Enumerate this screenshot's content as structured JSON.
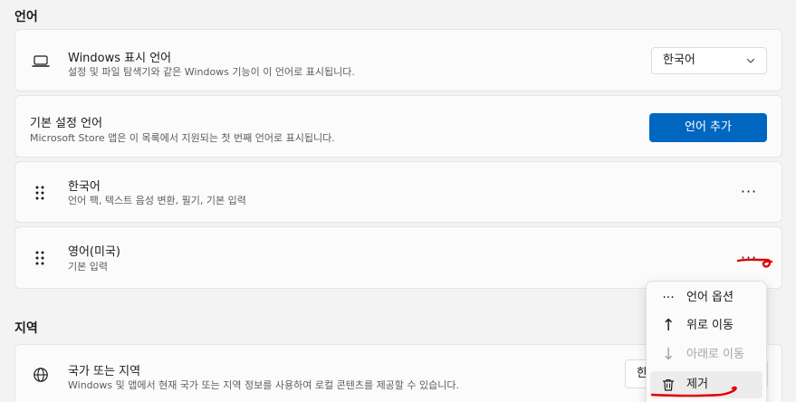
{
  "language_section": {
    "title": "언어"
  },
  "display_language": {
    "title": "Windows 표시 언어",
    "description": "설정 및 파일 탐색기와 같은 Windows 기능이 이 언어로 표시됩니다.",
    "selected": "한국어",
    "icon": "laptop-icon"
  },
  "preferred_language": {
    "title": "기본 설정 언어",
    "description": "Microsoft Store 앱은 이 목록에서 지원되는 첫 번째 언어로 표시됩니다.",
    "add_button": "언어 추가"
  },
  "languages": [
    {
      "name": "한국어",
      "features": "언어 팩, 텍스트 음성 변환, 필기, 기본 입력",
      "more": "···"
    },
    {
      "name": "영어(미국)",
      "features": "기본 입력",
      "more": "···"
    }
  ],
  "context_menu": {
    "items": [
      {
        "label": "언어 옵션",
        "icon": "more-icon",
        "glyph": "···",
        "enabled": true
      },
      {
        "label": "위로 이동",
        "icon": "arrow-up-icon",
        "glyph": "↑",
        "enabled": true
      },
      {
        "label": "아래로 이동",
        "icon": "arrow-down-icon",
        "glyph": "↓",
        "enabled": false
      },
      {
        "label": "제거",
        "icon": "trash-icon",
        "glyph": "",
        "enabled": true
      }
    ]
  },
  "region_section": {
    "title": "지역"
  },
  "country_region": {
    "title": "국가 또는 지역",
    "description": "Windows 및 앱에서 현재 국가 또는 지역 정보를 사용하여 로컬 콘텐츠를 제공할 수 있습니다.",
    "selected": "한",
    "icon": "globe-icon"
  },
  "colors": {
    "accent": "#0067c0",
    "annotation": "#e00000"
  }
}
